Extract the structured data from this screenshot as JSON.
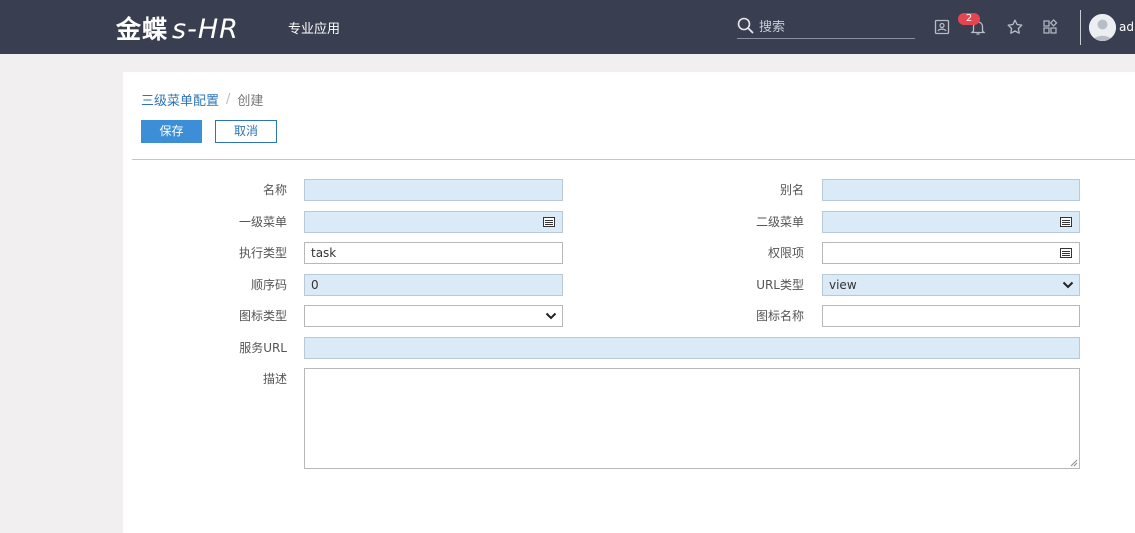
{
  "header": {
    "logo_cn": "金蝶",
    "logo_en": "s-HR",
    "nav_app": "专业应用",
    "search_placeholder": "搜索",
    "notification_count": "2",
    "user_name": "adm",
    "icons": [
      "search-icon",
      "contact-card-icon",
      "bell-icon",
      "star-icon",
      "apps-grid-icon",
      "user-avatar-icon"
    ]
  },
  "breadcrumb": {
    "parent": "三级菜单配置",
    "separator": "/",
    "current": "创建"
  },
  "toolbar": {
    "save_label": "保存",
    "cancel_label": "取消"
  },
  "form": {
    "name": {
      "label": "名称",
      "value": ""
    },
    "alias": {
      "label": "别名",
      "value": ""
    },
    "level1_menu": {
      "label": "一级菜单",
      "value": ""
    },
    "level2_menu": {
      "label": "二级菜单",
      "value": ""
    },
    "exec_type": {
      "label": "执行类型",
      "value": "task"
    },
    "permission": {
      "label": "权限项",
      "value": ""
    },
    "order_code": {
      "label": "顺序码",
      "value": "0"
    },
    "url_type": {
      "label": "URL类型",
      "value": "view"
    },
    "icon_type": {
      "label": "图标类型",
      "value": ""
    },
    "icon_name": {
      "label": "图标名称",
      "value": ""
    },
    "service_url": {
      "label": "服务URL",
      "value": ""
    },
    "description": {
      "label": "描述",
      "value": ""
    }
  },
  "colors": {
    "header_bg": "#393f50",
    "primary": "#3c8fd6",
    "link": "#2e75b6",
    "readonly_field_bg": "#daeaf6",
    "badge": "#e5454f"
  }
}
